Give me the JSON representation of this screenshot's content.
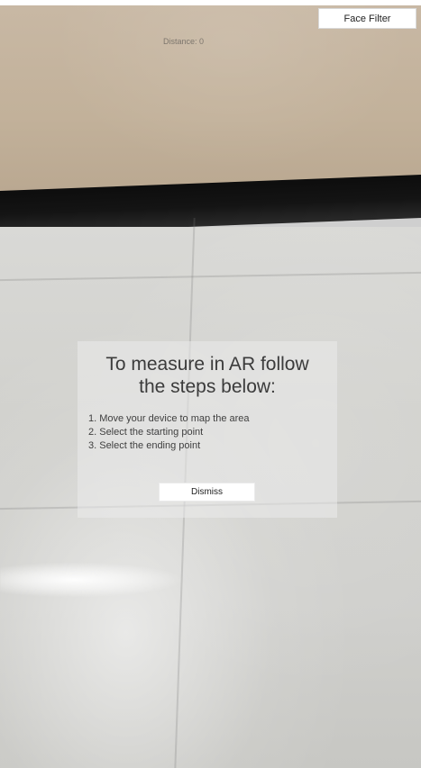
{
  "top_bar": {
    "face_filter_label": "Face Filter"
  },
  "hud": {
    "distance_text": "Distance: 0"
  },
  "instructions": {
    "title": "To measure in AR follow\nthe steps below:",
    "steps": [
      "1. Move your device to map the area",
      "2. Select the starting point",
      "3. Select the ending point"
    ],
    "dismiss_label": "Dismiss"
  }
}
